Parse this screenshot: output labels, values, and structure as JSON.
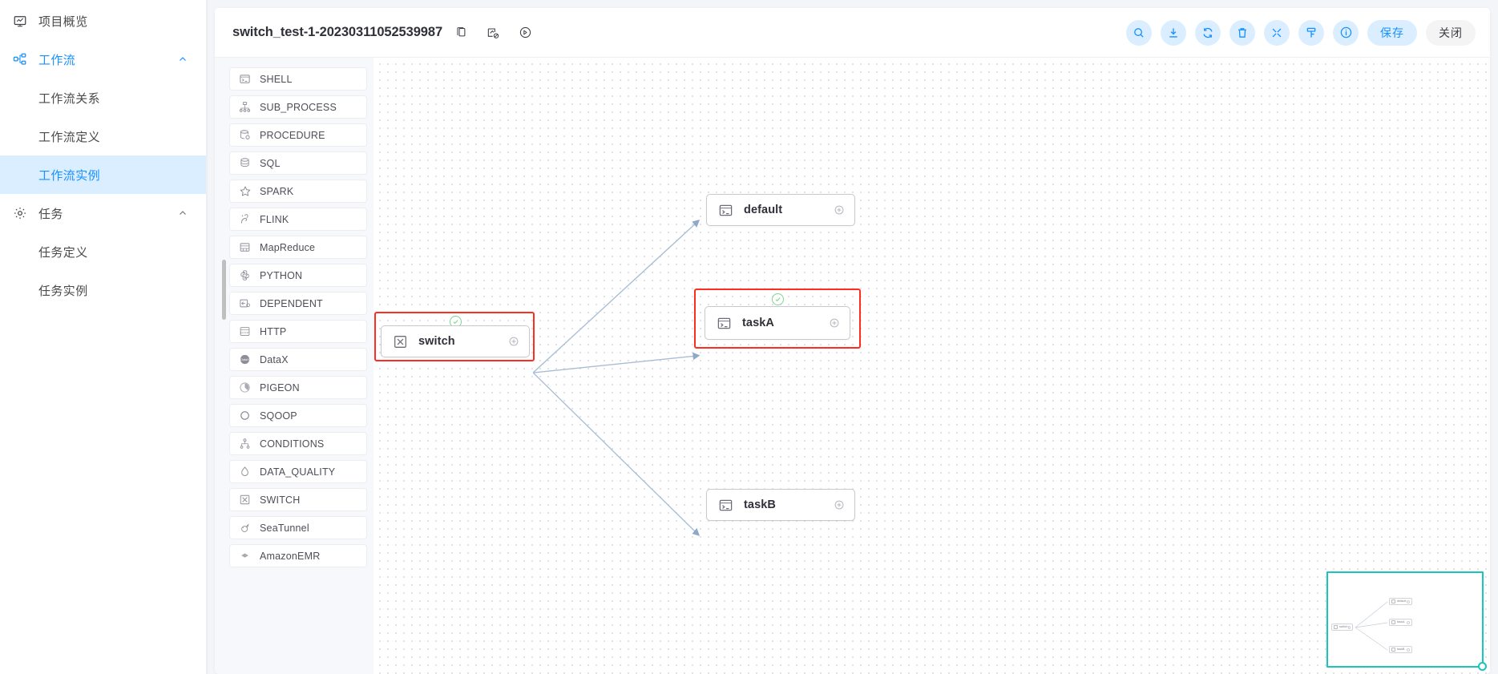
{
  "sidebar": {
    "items": [
      {
        "label": "项目概览",
        "icon": "project-overview-icon",
        "type": "top",
        "active": false
      },
      {
        "label": "工作流",
        "icon": "workflow-icon",
        "type": "parent",
        "active": true,
        "chevron": "chevron-up-icon"
      },
      {
        "label": "工作流关系",
        "type": "sub",
        "selected": false
      },
      {
        "label": "工作流定义",
        "type": "sub",
        "selected": false
      },
      {
        "label": "工作流实例",
        "type": "sub",
        "selected": true
      },
      {
        "label": "任务",
        "icon": "gear-icon",
        "type": "parent",
        "active": false,
        "chevron": "chevron-up-icon"
      },
      {
        "label": "任务定义",
        "type": "sub",
        "selected": false
      },
      {
        "label": "任务实例",
        "type": "sub",
        "selected": false
      }
    ]
  },
  "topbar": {
    "workflow_name": "switch_test-1-20230311052539987",
    "title_icons": [
      "copy-icon",
      "edit-disabled-icon",
      "clock-arrow-icon"
    ],
    "tools": [
      {
        "name": "search-icon",
        "title": "搜索"
      },
      {
        "name": "download-icon",
        "title": "下载"
      },
      {
        "name": "refresh-icon",
        "title": "刷新"
      },
      {
        "name": "delete-icon",
        "title": "删除"
      },
      {
        "name": "fullscreen-icon",
        "title": "全屏"
      },
      {
        "name": "format-icon",
        "title": "格式化"
      },
      {
        "name": "info-icon",
        "title": "说明"
      }
    ],
    "save_label": "保存",
    "close_label": "关闭"
  },
  "palette": {
    "items": [
      {
        "label": "SHELL",
        "icon": "shell-icon"
      },
      {
        "label": "SUB_PROCESS",
        "icon": "subprocess-icon"
      },
      {
        "label": "PROCEDURE",
        "icon": "procedure-icon"
      },
      {
        "label": "SQL",
        "icon": "sql-icon"
      },
      {
        "label": "SPARK",
        "icon": "spark-icon"
      },
      {
        "label": "FLINK",
        "icon": "flink-icon"
      },
      {
        "label": "MapReduce",
        "icon": "mapreduce-icon"
      },
      {
        "label": "PYTHON",
        "icon": "python-icon"
      },
      {
        "label": "DEPENDENT",
        "icon": "dependent-icon"
      },
      {
        "label": "HTTP",
        "icon": "http-icon"
      },
      {
        "label": "DataX",
        "icon": "datax-icon"
      },
      {
        "label": "PIGEON",
        "icon": "pigeon-icon"
      },
      {
        "label": "SQOOP",
        "icon": "sqoop-icon"
      },
      {
        "label": "CONDITIONS",
        "icon": "conditions-icon"
      },
      {
        "label": "DATA_QUALITY",
        "icon": "dataquality-icon"
      },
      {
        "label": "SWITCH",
        "icon": "switch-icon"
      },
      {
        "label": "SeaTunnel",
        "icon": "seatunnel-icon"
      },
      {
        "label": "AmazonEMR",
        "icon": "amazonemr-icon"
      }
    ]
  },
  "canvas": {
    "nodes": [
      {
        "id": "switch",
        "label": "switch",
        "icon": "switch-icon",
        "selected": true,
        "status": "success"
      },
      {
        "id": "default",
        "label": "default",
        "icon": "shell-icon",
        "selected": false,
        "status": "none"
      },
      {
        "id": "taskA",
        "label": "taskA",
        "icon": "shell-icon",
        "selected": true,
        "status": "success"
      },
      {
        "id": "taskB",
        "label": "taskB",
        "icon": "shell-icon",
        "selected": false,
        "status": "none"
      }
    ],
    "edges": [
      {
        "from": "switch",
        "to": "default"
      },
      {
        "from": "switch",
        "to": "taskA"
      },
      {
        "from": "switch",
        "to": "taskB"
      }
    ],
    "minimap": {
      "nodes": [
        {
          "label": "switch"
        },
        {
          "label": "default"
        },
        {
          "label": "taskA"
        },
        {
          "label": "taskB"
        }
      ]
    }
  },
  "colors": {
    "accent": "#1890ff",
    "accent_soft": "#dbeeff",
    "selection": "#ff2d20",
    "success": "#7ed492",
    "minimap_border": "#19c5bf",
    "canvas_dot": "#d8d8dd"
  }
}
